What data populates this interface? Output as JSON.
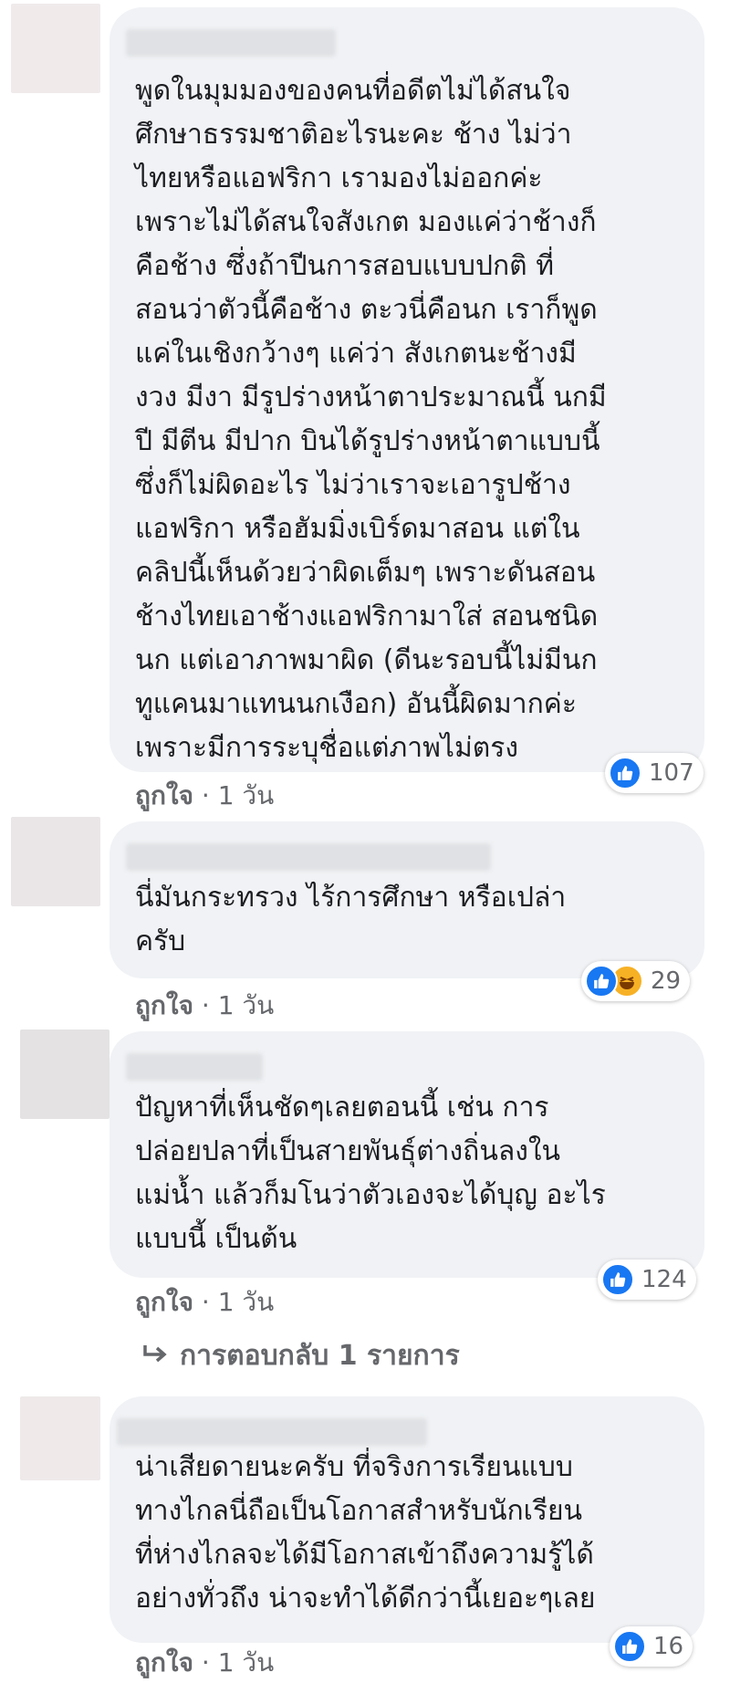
{
  "comments": [
    {
      "text": "พูดในมุมมองของคนที่อดีตไม่ได้สนใจ\nศึกษาธรรมชาติอะไรนะคะ ช้าง ไม่ว่า\nไทยหรือแอฟริกา เรามองไม่ออกค่ะ\nเพราะไม่ได้สนใจสังเกต มองแค่ว่าช้างก็\nคือช้าง ซึ่งถ้าปีนการสอบแบบปกติ ที่\nสอนว่าตัวนี้คือช้าง ตะวนี่คือนก เราก็พูด\nแค่ในเชิงกว้างๆ แค่ว่า สังเกตนะช้างมี\nงวง มีงา มีรูปร่างหน้าตาประมาณนี้ นกมี\nปี มีตีน มีปาก บินได้รูปร่างหน้าตาแบบนี้\nซึ่งก็ไม่ผิดอะไร ไม่ว่าเราจะเอารูปช้าง\nแอฟริกา หรือฮัมมิ่งเบิร์ดมาสอน แต่ใน\nคลิปนี้เห็นด้วยว่าผิดเต็มๆ เพราะดันสอน\nช้างไทยเอาช้างแอฟริกามาใส่ สอนชนิด\nนก แต่เอาภาพมาผิด (ดีนะรอบนี้ไม่มีนก\nทูแคนมาแทนนกเงือก) อันนี้ผิดมากค่ะ\nเพราะมีการระบุชื่อแต่ภาพไม่ตรง",
      "reaction_count": "107",
      "like_label": "ถูกใจ",
      "time": "1 วัน"
    },
    {
      "text": "นี่มันกระทรวง ไร้การศึกษา หรือเปล่า\nครับ",
      "reaction_count": "29",
      "like_label": "ถูกใจ",
      "time": "1 วัน"
    },
    {
      "text": "ปัญหาที่เห็นชัดๆเลยตอนนี้ เช่น การ\nปล่อยปลาที่เป็นสายพันธุ์ต่างถิ่นลงใน\nแม่น้ำ แล้วก็มโนว่าตัวเองจะได้บุญ อะไร\nแบบนี้ เป็นต้น",
      "reaction_count": "124",
      "like_label": "ถูกใจ",
      "time": "1 วัน",
      "reply_label": "การตอบกลับ 1 รายการ"
    },
    {
      "text": "น่าเสียดายนะครับ ที่จริงการเรียนแบบ\nทางไกลนี่ถือเป็นโอกาสสำหรับนักเรียน\nที่ห่างไกลจะได้มีโอกาสเข้าถึงความรู้ได้\nอย่างทั่วถึง น่าจะทำได้ดีกว่านี้เยอะๆเลย",
      "reaction_count": "16",
      "like_label": "ถูกใจ",
      "time": "1 วัน"
    }
  ],
  "icons": {
    "like": "like-icon",
    "haha": "haha-icon",
    "reply_arrow": "reply-arrow-icon"
  },
  "colors": {
    "bubble": "#f0f2f5",
    "like_blue": "#1877f2",
    "haha_yellow": "#f7b125",
    "meta_gray": "#65676b"
  }
}
